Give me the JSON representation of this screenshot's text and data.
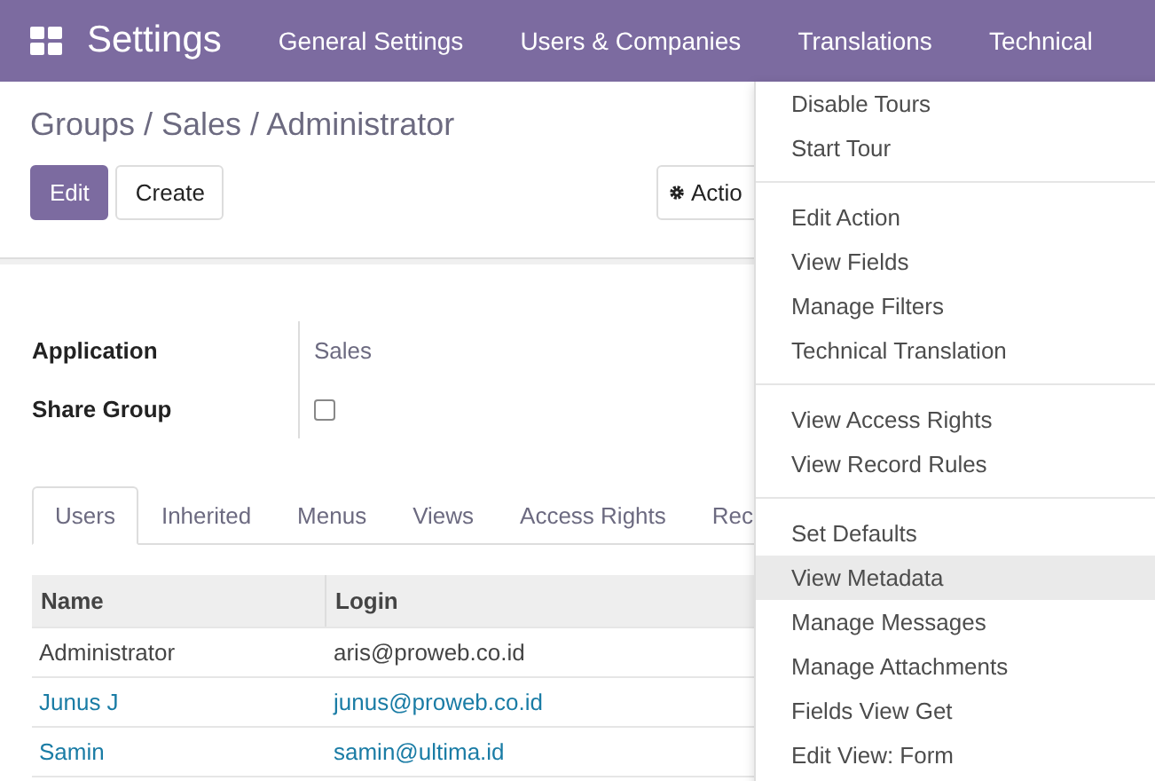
{
  "navbar": {
    "app_title": "Settings",
    "menu": [
      "General Settings",
      "Users & Companies",
      "Translations",
      "Technical"
    ]
  },
  "breadcrumb": "Groups / Sales / Administrator",
  "buttons": [
    {
      "label": "Edit",
      "kind": "primary"
    },
    {
      "label": "Create",
      "kind": "secondary"
    }
  ],
  "action_button": {
    "label": "Actio"
  },
  "fields": [
    {
      "label": "Application",
      "kind": "text",
      "value": "Sales"
    },
    {
      "label": "Share Group",
      "kind": "checkbox",
      "checked": false
    }
  ],
  "tabs": [
    {
      "label": "Users",
      "selected": true
    },
    {
      "label": "Inherited",
      "selected": false
    },
    {
      "label": "Menus",
      "selected": false
    },
    {
      "label": "Views",
      "selected": false
    },
    {
      "label": "Access Rights",
      "selected": false
    },
    {
      "label": "Rec",
      "selected": false
    }
  ],
  "table": {
    "columns": [
      "Name",
      "Login"
    ],
    "rows": [
      {
        "name": "Administrator",
        "login": "aris@proweb.co.id",
        "link": false
      },
      {
        "name": "Junus J",
        "login": "junus@proweb.co.id",
        "link": true
      },
      {
        "name": "Samin",
        "login": "samin@ultima.id",
        "link": true
      }
    ]
  },
  "dropdown": {
    "groups": [
      [
        {
          "label": "Disable Tours",
          "selected": false
        },
        {
          "label": "Start Tour",
          "selected": false
        }
      ],
      [
        {
          "label": "Edit Action",
          "selected": false
        },
        {
          "label": "View Fields",
          "selected": false
        },
        {
          "label": "Manage Filters",
          "selected": false
        },
        {
          "label": "Technical Translation",
          "selected": false
        }
      ],
      [
        {
          "label": "View Access Rights",
          "selected": false
        },
        {
          "label": "View Record Rules",
          "selected": false
        }
      ],
      [
        {
          "label": "Set Defaults",
          "selected": false
        },
        {
          "label": "View Metadata",
          "selected": true
        },
        {
          "label": "Manage Messages",
          "selected": false
        },
        {
          "label": "Manage Attachments",
          "selected": false
        },
        {
          "label": "Fields View Get",
          "selected": false
        },
        {
          "label": "Edit View: Form",
          "selected": false
        }
      ]
    ]
  }
}
